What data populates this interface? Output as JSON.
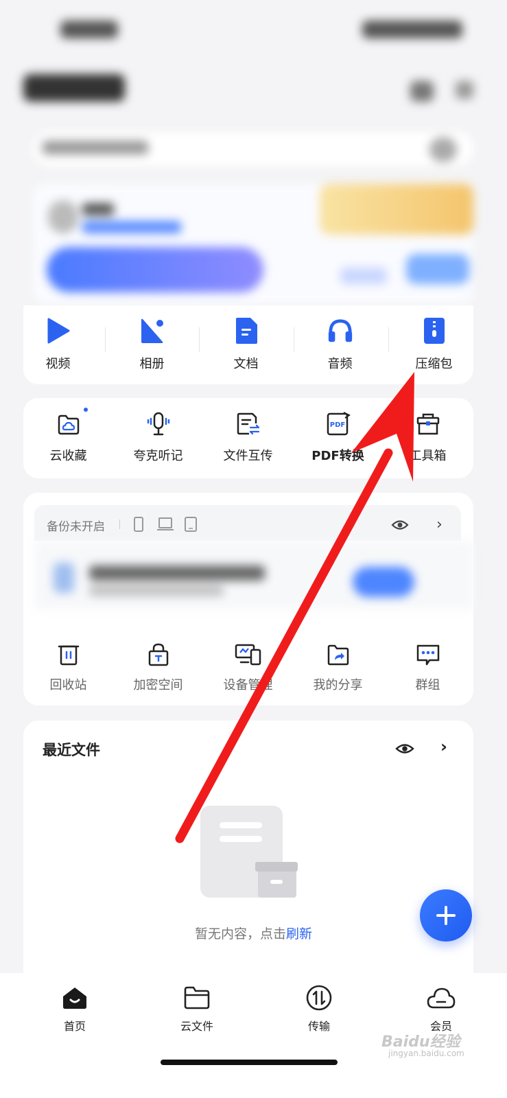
{
  "categories": [
    {
      "label": "视频",
      "icon": "play-icon"
    },
    {
      "label": "相册",
      "icon": "photo-album-icon"
    },
    {
      "label": "文档",
      "icon": "document-icon"
    },
    {
      "label": "音频",
      "icon": "headphones-icon"
    },
    {
      "label": "压缩包",
      "icon": "zip-file-icon"
    }
  ],
  "tools": [
    {
      "label": "云收藏",
      "icon": "cloud-folder-icon"
    },
    {
      "label": "夸克听记",
      "icon": "microphone-icon"
    },
    {
      "label": "文件互传",
      "icon": "file-transfer-icon"
    },
    {
      "label": "PDF转换",
      "icon": "pdf-icon"
    },
    {
      "label": "工具箱",
      "icon": "toolbox-icon"
    }
  ],
  "backup": {
    "label": "备份未开启"
  },
  "utilities": [
    {
      "label": "回收站",
      "icon": "trash-icon"
    },
    {
      "label": "加密空间",
      "icon": "lock-icon"
    },
    {
      "label": "设备管理",
      "icon": "devices-icon"
    },
    {
      "label": "我的分享",
      "icon": "share-icon"
    },
    {
      "label": "群组",
      "icon": "chat-group-icon"
    }
  ],
  "recent": {
    "title": "最近文件",
    "empty_text": "暂无内容，点击",
    "refresh_label": "刷新"
  },
  "nav": [
    {
      "label": "首页",
      "icon": "home-icon"
    },
    {
      "label": "云文件",
      "icon": "folder-icon"
    },
    {
      "label": "传输",
      "icon": "transfer-icon"
    },
    {
      "label": "会员",
      "icon": "cloud-icon"
    }
  ],
  "watermark": {
    "text": "Baidu经验",
    "sub": "jingyan.baidu.com"
  },
  "colors": {
    "accent": "#2b63f0",
    "arrow": "#f01c1c"
  }
}
